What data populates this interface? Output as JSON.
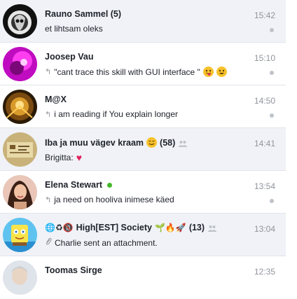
{
  "conversations": [
    {
      "name": "Rauno Sammel (5)",
      "snippet": "et lihtsam oleks",
      "time": "15:42"
    },
    {
      "name": "Joosep Vau",
      "snippet": "\"cant trace this skill with GUI interface \"",
      "time": "15:10"
    },
    {
      "name": "M@X",
      "snippet": "i am reading if You explain longer",
      "time": "14:50"
    },
    {
      "name": "Iba ja muu vägev kraam",
      "name_suffix": "(58)",
      "snippet": "Brigitta:",
      "time": "14:41"
    },
    {
      "name": "Elena Stewart",
      "snippet": "ja need on hooliva inimese käed",
      "time": "13:54"
    },
    {
      "name_prefix": "🌐♻🔞",
      "name": "High[EST] Society",
      "name_emoji": "🌱🔥🚀",
      "name_suffix": "(13)",
      "snippet": "Charlie sent an attachment.",
      "time": "13:04"
    },
    {
      "name": "Toomas Sirge",
      "time": "12:35"
    }
  ],
  "icons": {
    "reply": "reply-arrow-icon",
    "group": "group-people-icon",
    "attachment": "paperclip-icon",
    "status": "read-status-dot-icon",
    "online": "online-status-icon"
  },
  "colors": {
    "unread_background": "#f0f2f7",
    "online": "#42b72a",
    "time_text": "#90949c"
  }
}
